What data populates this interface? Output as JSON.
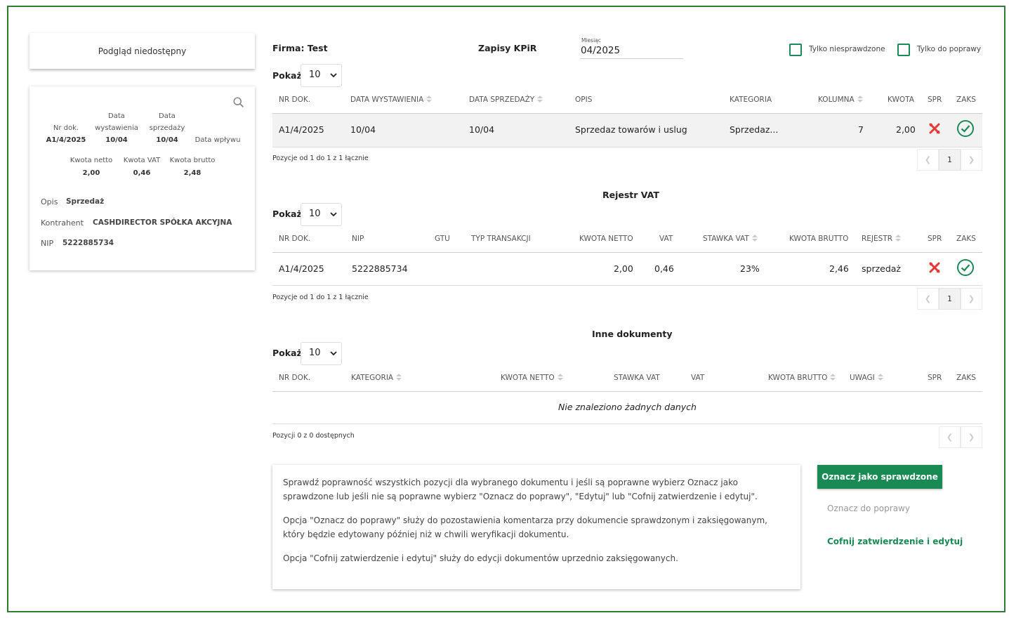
{
  "left": {
    "preview_unavailable": "Podgląd niedostępny",
    "doc": {
      "nr_label": "Nr dok.",
      "nr_value": "A1/4/2025",
      "data_wyst_label_1": "Data",
      "data_wyst_label_2": "wystawienia",
      "data_wyst_value": "10/04",
      "data_sprz_label_1": "Data",
      "data_sprz_label_2": "sprzedaży",
      "data_sprz_value": "10/04",
      "data_wplywu_label": "Data wpływu",
      "netto_label": "Kwota netto",
      "netto_value": "2,00",
      "vat_label": "Kwota VAT",
      "vat_value": "0,46",
      "brutto_label": "Kwota brutto",
      "brutto_value": "2,48",
      "opis_label": "Opis",
      "opis_value": "Sprzedaż",
      "kontrahent_label": "Kontrahent",
      "kontrahent_value": "CASHDIRECTOR SPÓŁKA AKCYJNA",
      "nip_label": "NIP",
      "nip_value": "5222885734"
    }
  },
  "header": {
    "firma": "Firma: Test",
    "title": "Zapisy KPiR",
    "month_label": "Miesiąc",
    "month_value": "04/2025",
    "filter_unchecked": "Tylko niesprawdzone",
    "filter_to_fix": "Tylko do poprawy"
  },
  "common": {
    "show_label": "Pokaż",
    "show_value": "10"
  },
  "kpir": {
    "columns": [
      "NR DOK.",
      "DATA WYSTAWIENIA",
      "DATA SPRZEDAŻY",
      "OPIS",
      "KATEGORIA",
      "KOLUMNA",
      "KWOTA",
      "SPR",
      "ZAKS"
    ],
    "rows": [
      {
        "nr": "A1/4/2025",
        "data_wyst": "10/04",
        "data_sprz": "10/04",
        "opis": "Sprzedaz towarów i uslug",
        "kategoria": "Sprzedaz...",
        "kolumna": "7",
        "kwota": "2,00"
      }
    ],
    "info": "Pozycje od 1 do 1 z 1 łącznie",
    "page": "1"
  },
  "vat": {
    "title": "Rejestr VAT",
    "columns": [
      "NR DOK.",
      "NIP",
      "GTU",
      "TYP TRANSAKCJI",
      "KWOTA NETTO",
      "VAT",
      "STAWKA VAT",
      "KWOTA BRUTTO",
      "REJESTR",
      "SPR",
      "ZAKS"
    ],
    "rows": [
      {
        "nr": "A1/4/2025",
        "nip": "5222885734",
        "netto": "2,00",
        "vat": "0,46",
        "stawka": "23%",
        "brutto": "2,46",
        "rejestr": "sprzedaż"
      }
    ],
    "info": "Pozycje od 1 do 1 z 1 łącznie",
    "page": "1"
  },
  "inne": {
    "title": "Inne dokumenty",
    "columns": [
      "NR DOK.",
      "KATEGORIA",
      "KWOTA NETTO",
      "STAWKA VAT",
      "VAT",
      "KWOTA BRUTTO",
      "UWAGI",
      "SPR",
      "ZAKS"
    ],
    "empty": "Nie znaleziono żadnych danych",
    "info": "Pozycji 0 z 0 dostępnych"
  },
  "instructions": {
    "p1": "Sprawdź poprawność wszystkich pozycji dla wybranego dokumentu i jeśli są poprawne wybierz Oznacz jako sprawdzone lub jeśli nie są poprawne wybierz \"Oznacz do poprawy\", \"Edytuj\" lub \"Cofnij zatwierdzenie i edytuj\".",
    "p2": "Opcja \"Oznacz do poprawy\" służy do pozostawienia komentarza przy dokumencie sprawdzonym i zaksięgowanym, który będzie edytowany później niż w chwili weryfikacji dokumentu.",
    "p3": "Opcja \"Cofnij zatwierdzenie i edytuj\" służy do edycji dokumentów uprzednio zaksięgowanych."
  },
  "actions": {
    "mark_checked": "Oznacz jako sprawdzone",
    "mark_fix": "Oznacz do poprawy",
    "undo_edit": "Cofnij zatwierdzenie i edytuj"
  },
  "colors": {
    "accent_green": "#1a8a55",
    "frame_green": "#2e7d32",
    "tools_red": "#e53935"
  }
}
